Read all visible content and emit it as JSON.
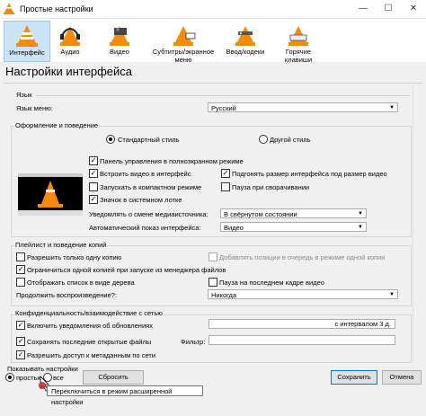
{
  "window": {
    "title": "Простые настройки",
    "minimize": "—",
    "maximize": "☐",
    "close": "✕"
  },
  "toolbar": [
    {
      "label": "Интерфейс",
      "icon": "interface-cone-icon"
    },
    {
      "label": "Аудио",
      "icon": "headphones-cone-icon"
    },
    {
      "label": "Видео",
      "icon": "video-cone-icon"
    },
    {
      "label": "Субтитры/экранное меню",
      "icon": "subtitles-cone-icon"
    },
    {
      "label": "Ввод/кодеки",
      "icon": "input-codecs-cone-icon"
    },
    {
      "label": "Горячие клавиши",
      "icon": "hotkeys-cone-icon"
    }
  ],
  "page_title": "Настройки интерфейса",
  "language": {
    "section": "Язык",
    "menu_label": "Язык меню:",
    "menu_value": "Русский"
  },
  "look": {
    "section": "Оформление и поведение",
    "style_native": "Стандартный стиль",
    "style_other": "Другой стиль",
    "fullscreen_panel": "Панель управления в полноэкранном режиме",
    "embed_video": "Встроить видео в интерфейс",
    "resize_iface": "Подгонять размер интерфейса под размер видео",
    "compact_start": "Запускать в компактном режиме",
    "pause_minimized": "Пауза при сворачивании",
    "systray": "Значок в системном лотке",
    "notify_label": "Уведомлять о смене медиаисточника:",
    "notify_value": "В свёрнутом состоянии",
    "autoraise_label": "Автоматический показ интерфейса:",
    "autoraise_value": "Видео"
  },
  "playlist": {
    "section": "Плейлист и поведение копий",
    "one_instance": "Разрешить только одну копию",
    "enqueue": "Добавлять позиции в очередь в режиме одной копии",
    "limit_fm": "Ограничиться одной копией при запуске из менеджера файлов",
    "tree": "Отображать список в виде дерева",
    "pause_last": "Пауза на последнем кадре видео",
    "continue_label": "Продолжить воспроизведение?:",
    "continue_value": "Никогда"
  },
  "privacy": {
    "section": "Конфиденциальность/взаимодействие с сетью",
    "updates": "Включить уведомления об обновлениях",
    "updates_interval": "с интервалом 3 д.",
    "recent": "Сохранять последние открытые файлы",
    "filter_label": "Фильтр:",
    "metadata": "Разрешить доступ к метаданным по сети"
  },
  "footer": {
    "show_label": "Показывать настройки",
    "simple": "простые",
    "all": "все",
    "reset": "Сбросить настройки",
    "save": "Сохранить",
    "cancel": "Отмена",
    "tooltip": "Переключиться в режим расширенной настройки"
  }
}
